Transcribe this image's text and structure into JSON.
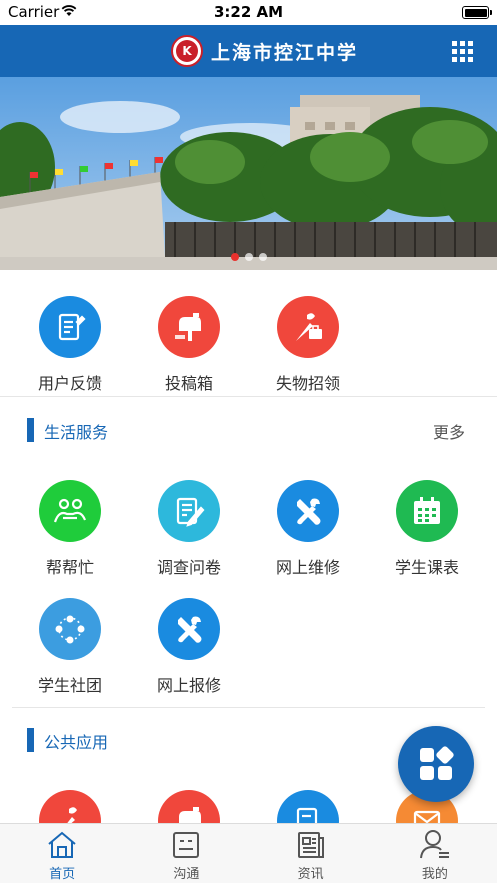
{
  "status_bar": {
    "carrier": "Carrier",
    "time": "3:22 AM"
  },
  "header": {
    "title": "上海市控江中学",
    "menu_icon": "grid-icon"
  },
  "banner": {
    "image": "school-gate-photo",
    "slide_count": 3,
    "active_slide": 1
  },
  "quick_actions": [
    {
      "label": "用户反馈",
      "icon": "feedback-icon",
      "color": "#1a8be0"
    },
    {
      "label": "投稿箱",
      "icon": "mailbox-icon",
      "color": "#f0473c"
    },
    {
      "label": "失物招领",
      "icon": "lost-found-icon",
      "color": "#f0473c"
    }
  ],
  "sections": {
    "life": {
      "title": "生活服务",
      "more": "更多",
      "items": [
        {
          "label": "帮帮忙",
          "icon": "help-icon",
          "color": "#1fcc3b"
        },
        {
          "label": "调查问卷",
          "icon": "survey-icon",
          "color": "#2db8dc"
        },
        {
          "label": "网上维修",
          "icon": "repair-tools-icon",
          "color": "#1a8be0"
        },
        {
          "label": "学生课表",
          "icon": "calendar-icon",
          "color": "#1fba52"
        },
        {
          "label": "学生社团",
          "icon": "club-icon",
          "color": "#3c9de0"
        },
        {
          "label": "网上报修",
          "icon": "repair-report-icon",
          "color": "#1a8be0"
        }
      ]
    },
    "public": {
      "title": "公共应用",
      "items": [
        {
          "icon": "lost-found-icon",
          "color": "#f0473c"
        },
        {
          "icon": "mailbox-icon",
          "color": "#f0473c"
        },
        {
          "icon": "document-icon",
          "color": "#1a8be0"
        },
        {
          "icon": "envelope-icon",
          "color": "#f58a34"
        }
      ]
    }
  },
  "tabbar": [
    {
      "label": "首页",
      "icon": "home-icon",
      "active": true
    },
    {
      "label": "沟通",
      "icon": "chat-icon",
      "active": false
    },
    {
      "label": "资讯",
      "icon": "news-icon",
      "active": false
    },
    {
      "label": "我的",
      "icon": "profile-icon",
      "active": false
    }
  ],
  "colors": {
    "brand": "#1767b5",
    "active_dot": "#e8312d"
  }
}
